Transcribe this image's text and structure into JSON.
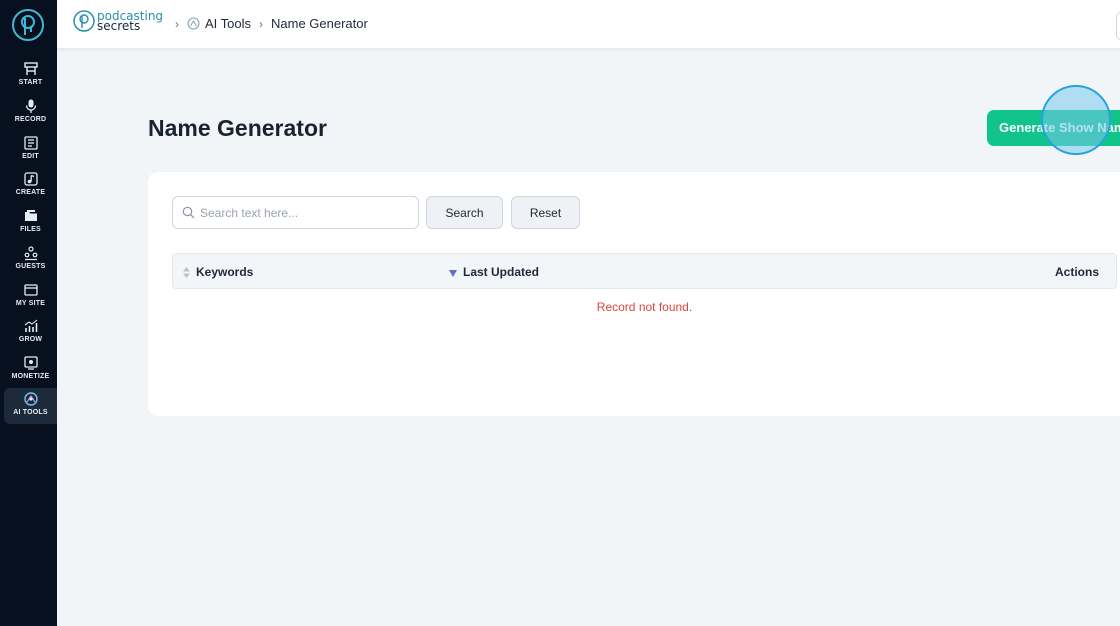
{
  "sidebar": {
    "items": [
      {
        "label": "START",
        "icon": "start-icon"
      },
      {
        "label": "RECORD",
        "icon": "microphone-icon"
      },
      {
        "label": "EDIT",
        "icon": "edit-icon"
      },
      {
        "label": "CREATE",
        "icon": "music-note-icon"
      },
      {
        "label": "FILES",
        "icon": "files-icon"
      },
      {
        "label": "GUESTS",
        "icon": "guests-icon"
      },
      {
        "label": "MY SITE",
        "icon": "browser-icon"
      },
      {
        "label": "GROW",
        "icon": "chart-icon"
      },
      {
        "label": "MONETIZE",
        "icon": "monetize-icon"
      },
      {
        "label": "AI TOOLS",
        "icon": "ai-tools-icon",
        "active": true
      }
    ]
  },
  "header": {
    "brand_line1": "podcasting",
    "brand_line2": "secrets",
    "breadcrumb": [
      "AI Tools",
      "Name Generator"
    ]
  },
  "page": {
    "title": "Name Generator",
    "generate_button": "Generate Show Name"
  },
  "filters": {
    "search_placeholder": "Search text here...",
    "search_value": "",
    "search_button": "Search",
    "reset_button": "Reset"
  },
  "table": {
    "columns": [
      "Keywords",
      "Last Updated",
      "Actions"
    ],
    "empty_message": "Record not found."
  },
  "colors": {
    "sidebar_bg": "#06101f",
    "accent_green": "#10c48a",
    "error_text": "#d9463e",
    "brand_teal": "#2a8fa8"
  }
}
